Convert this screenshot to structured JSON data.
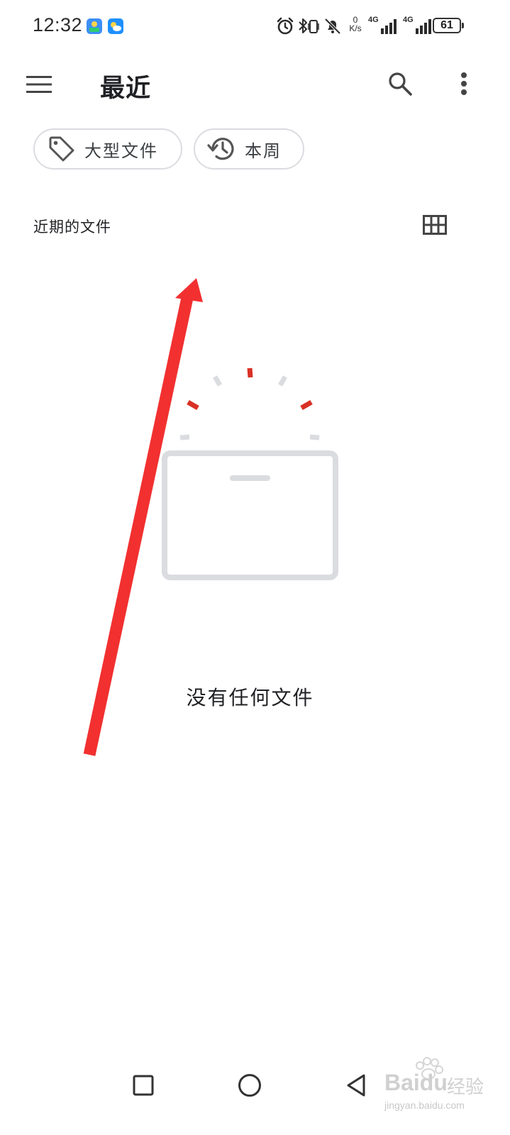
{
  "status_bar": {
    "time": "12:32",
    "net_speed_value": "0",
    "net_speed_unit": "K/s",
    "signal_1_label": "4G",
    "signal_2_label": "4G",
    "battery": "61"
  },
  "app_bar": {
    "title": "最近",
    "icons": [
      "menu-icon",
      "search-icon",
      "more-vert-icon"
    ]
  },
  "chips": [
    {
      "label": "大型文件",
      "icon": "tag-icon"
    },
    {
      "label": "本周",
      "icon": "history-icon"
    }
  ],
  "section": {
    "title": "近期的文件",
    "view_toggle_icon": "grid-view-icon"
  },
  "empty_state": {
    "message": "没有任何文件",
    "illustration": "empty-box-illustration",
    "accent_color": "#d93025",
    "muted_color": "#dadce0"
  },
  "annotation": {
    "arrow_color": "#f23030"
  },
  "nav_bar": {
    "icons": [
      "recents-square-icon",
      "home-circle-icon",
      "back-triangle-icon"
    ]
  },
  "watermark": {
    "brand": "Baidu",
    "sub": "经验",
    "url": "jingyan.baidu.com"
  }
}
